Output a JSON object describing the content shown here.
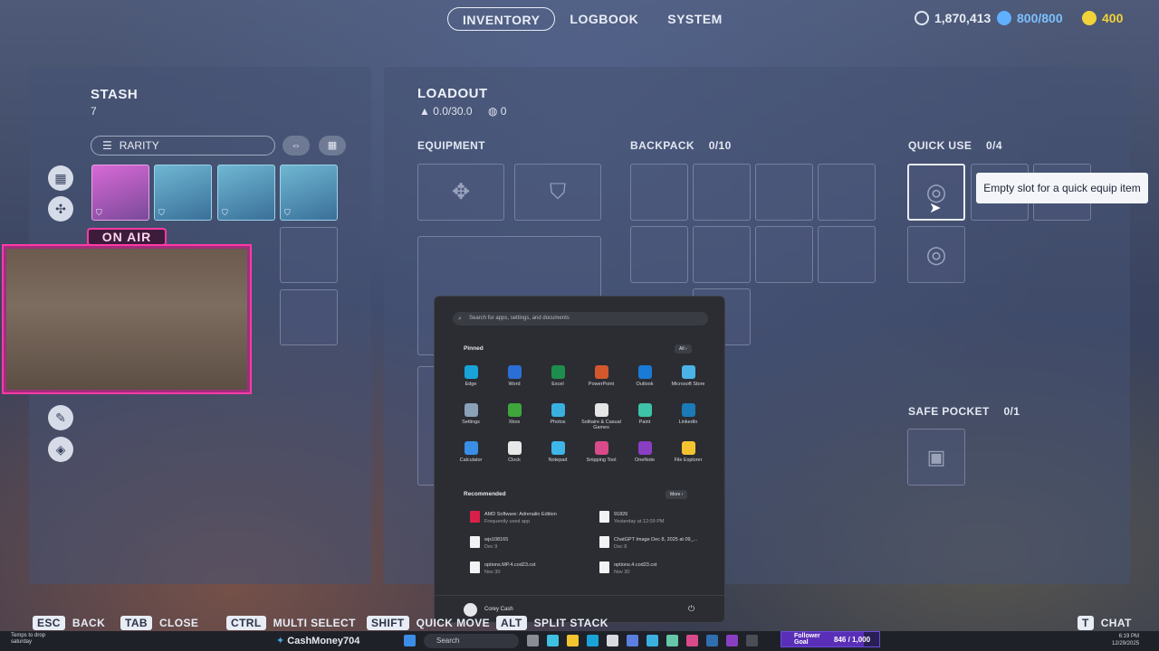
{
  "nav": {
    "tabs": [
      {
        "label": "INVENTORY",
        "active": true
      },
      {
        "label": "LOGBOOK",
        "active": false
      },
      {
        "label": "SYSTEM",
        "active": false
      }
    ]
  },
  "currencies": {
    "credits": {
      "value": "1,870,413",
      "icon": "coin-icon",
      "color": "#dfe6f3"
    },
    "tokens": {
      "value": "800/800",
      "icon": "token-icon",
      "color": "#5fb0ff"
    },
    "cash": {
      "value": "400",
      "icon": "gold-icon",
      "color": "#f2d23a"
    }
  },
  "stash": {
    "title": "STASH",
    "count": "7",
    "filter_label": "RARITY",
    "sidebar_icons": [
      "grid-icon",
      "parts-icon",
      "weapon-icon",
      "wrench-icon",
      "cube-icon"
    ]
  },
  "loadout": {
    "title": "LOADOUT",
    "weight": "0.0/30.0",
    "value": "0",
    "equipment_label": "EQUIPMENT",
    "backpack_label": "BACKPACK",
    "backpack_count": "0/10",
    "quick_use_label": "QUICK USE",
    "quick_use_count": "0/4",
    "safe_pocket_label": "SAFE POCKET",
    "safe_pocket_count": "0/1"
  },
  "tooltip": {
    "text": "Empty slot for a quick equip item"
  },
  "overlay": {
    "on_air": "ON AIR"
  },
  "start_menu": {
    "search_placeholder": "Search for apps, settings, and documents",
    "pinned_label": "Pinned",
    "all_label": "All",
    "apps": [
      {
        "name": "Edge",
        "color": "#1aa3d9"
      },
      {
        "name": "Word",
        "color": "#2b6fd6"
      },
      {
        "name": "Excel",
        "color": "#1e8e4e"
      },
      {
        "name": "PowerPoint",
        "color": "#d2572d"
      },
      {
        "name": "Outlook",
        "color": "#1a7bd6"
      },
      {
        "name": "Microsoft Store",
        "color": "#4bb3e8"
      },
      {
        "name": "Settings",
        "color": "#8aa1b8"
      },
      {
        "name": "Xbox",
        "color": "#3ea63a"
      },
      {
        "name": "Photos",
        "color": "#3ab0e0"
      },
      {
        "name": "Solitaire & Casual Games",
        "color": "#e5e5e5"
      },
      {
        "name": "Paint",
        "color": "#3fc3a8"
      },
      {
        "name": "LinkedIn",
        "color": "#1b7ab8"
      },
      {
        "name": "Calculator",
        "color": "#3a8ee6"
      },
      {
        "name": "Clock",
        "color": "#e8e8e8"
      },
      {
        "name": "Notepad",
        "color": "#3fb6e8"
      },
      {
        "name": "Snipping Tool",
        "color": "#d94a8a"
      },
      {
        "name": "OneNote",
        "color": "#8a3fc2"
      },
      {
        "name": "File Explorer",
        "color": "#f4c430"
      }
    ],
    "recommended_label": "Recommended",
    "more_label": "More",
    "recommended": [
      {
        "title": "AMD Software: Adrenalin Edition",
        "sub": "Frequently used app"
      },
      {
        "title": "91826",
        "sub": "Yesterday at 12:09 PM"
      },
      {
        "title": "wjs108165",
        "sub": "Dec 9"
      },
      {
        "title": "ChatGPT Image Dec 8, 2025 at 09_...",
        "sub": "Dec 8"
      },
      {
        "title": "options.MP.4.cod23.cst",
        "sub": "Nov 30"
      },
      {
        "title": "options.4.cod23.cst",
        "sub": "Nov 30"
      }
    ],
    "user": "Corey Cash"
  },
  "hints": [
    {
      "key": "ESC",
      "label": "BACK"
    },
    {
      "key": "TAB",
      "label": "CLOSE"
    },
    {
      "key": "CTRL",
      "label": "MULTI SELECT"
    },
    {
      "key": "SHIFT",
      "label": "QUICK MOVE"
    },
    {
      "key": "ALT",
      "label": "SPLIT STACK"
    },
    {
      "key": "T",
      "label": "CHAT"
    }
  ],
  "taskbar": {
    "weather": "Temps to drop saturday",
    "twitter": "CashMoney704",
    "search_placeholder": "Search",
    "follower_goal_label": "Follower Goal",
    "follower_goal_value": "846 / 1,000",
    "follower_goal_progress": 0.846,
    "time": "6:19 PM",
    "date": "12/29/2025"
  }
}
